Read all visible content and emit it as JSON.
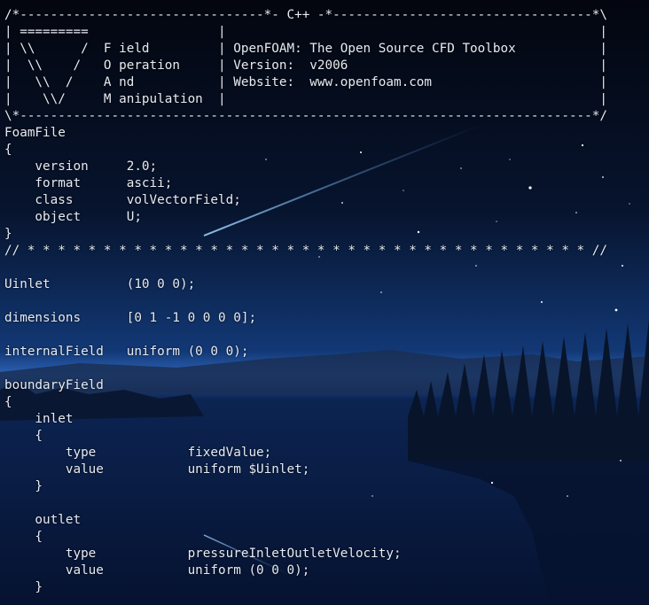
{
  "terminal": {
    "lines": [
      "/*--------------------------------*- C++ -*----------------------------------*\\",
      "| =========                 |                                                 |",
      "| \\\\      /  F ield         | OpenFOAM: The Open Source CFD Toolbox           |",
      "|  \\\\    /   O peration     | Version:  v2006                                 |",
      "|   \\\\  /    A nd           | Website:  www.openfoam.com                      |",
      "|    \\\\/     M anipulation  |                                                 |",
      "\\*---------------------------------------------------------------------------*/",
      "FoamFile",
      "{",
      "    version     2.0;",
      "    format      ascii;",
      "    class       volVectorField;",
      "    object      U;",
      "}",
      "// * * * * * * * * * * * * * * * * * * * * * * * * * * * * * * * * * * * * * //",
      "",
      "Uinlet          (10 0 0);",
      "",
      "dimensions      [0 1 -1 0 0 0 0];",
      "",
      "internalField   uniform (0 0 0);",
      "",
      "boundaryField",
      "{",
      "    inlet",
      "    {",
      "        type            fixedValue;",
      "        value           uniform $Uinlet;",
      "    }",
      "",
      "    outlet",
      "    {",
      "        type            pressureInletOutletVelocity;",
      "        value           uniform (0 0 0);",
      "    }"
    ]
  },
  "colors": {
    "text": "#e6ebf2",
    "sky_top": "#050a1a",
    "sky_mid": "#0f2a5c",
    "horizon_glow": "#2f6cc4",
    "water": "#0a1f45"
  }
}
